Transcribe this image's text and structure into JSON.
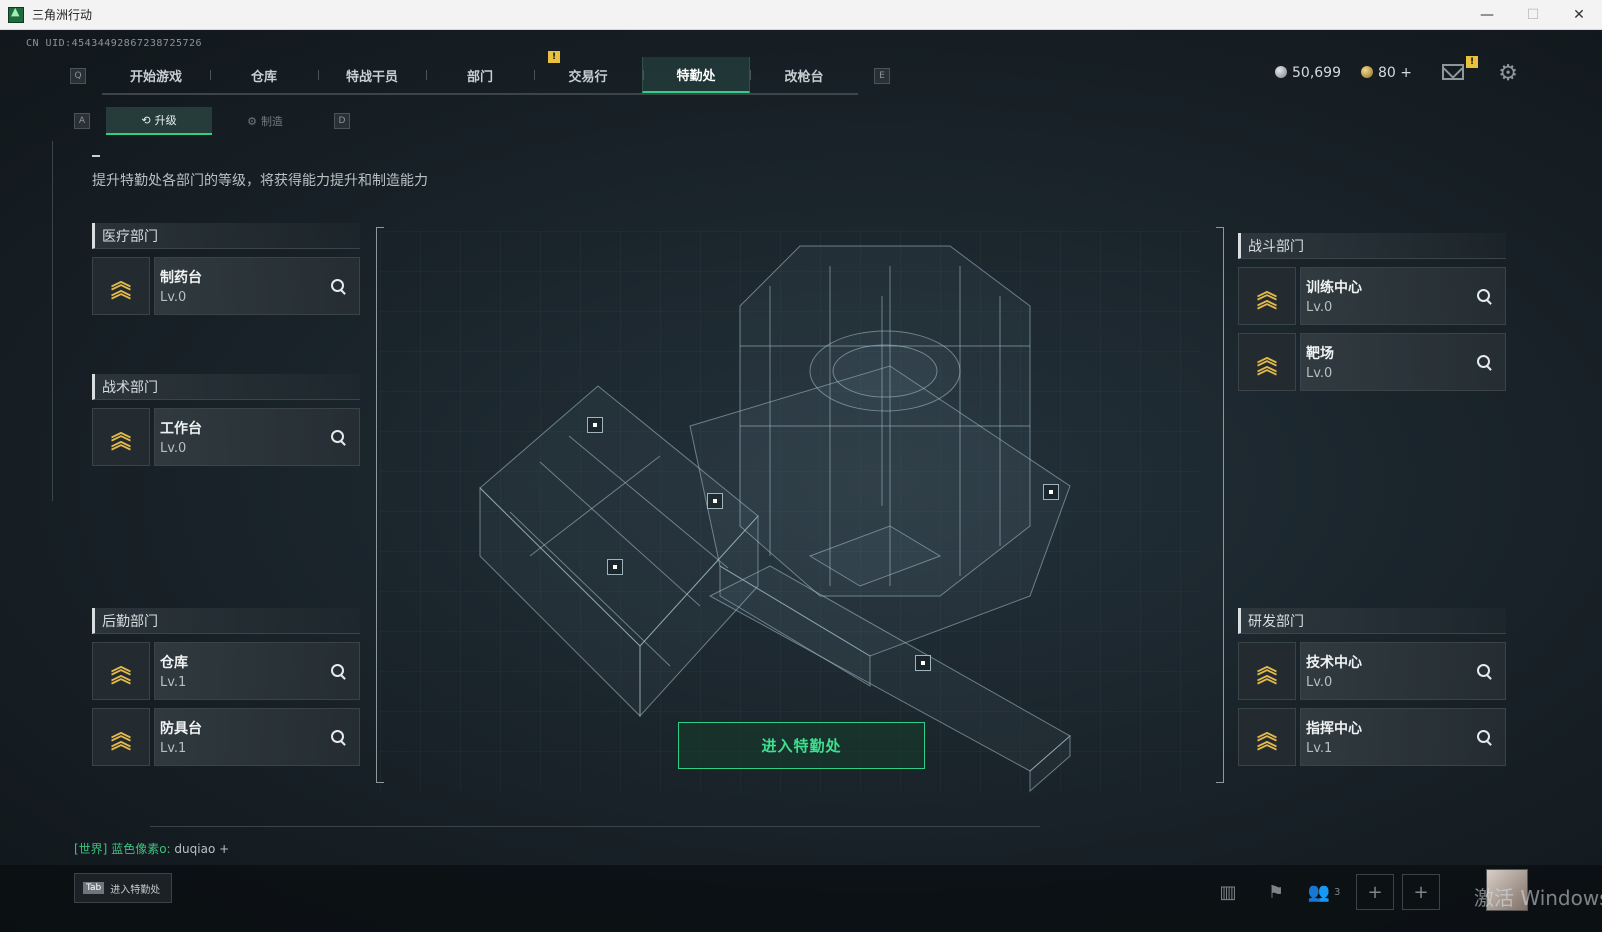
{
  "window": {
    "title": "三角洲行动",
    "minimize": "—",
    "maximize": "☐",
    "close": "✕"
  },
  "uid": "CN UID:4543449286723872572​6",
  "nav": {
    "left_key": "Q",
    "right_key": "E",
    "tabs": [
      "开始游戏",
      "仓库",
      "特战干员",
      "部门",
      "交易行",
      "特勤处",
      "改枪台"
    ],
    "active_tab": "特勤处",
    "warn_badge": "!"
  },
  "currency": {
    "silver": "50,699",
    "gold": "80 +"
  },
  "mail_badge": "!",
  "subtabs": {
    "left_key": "A",
    "right_key": "D",
    "upgrade": "升级",
    "craft": "制造"
  },
  "description": "提升特勤处各部门的等级，将获得能力提升和制造能力",
  "departments": {
    "medical": {
      "title": "医疗部门",
      "facilities": [
        {
          "name": "制药台",
          "level": "Lv.0"
        }
      ]
    },
    "tactical": {
      "title": "战术部门",
      "facilities": [
        {
          "name": "工作台",
          "level": "Lv.0"
        }
      ]
    },
    "logistics": {
      "title": "后勤部门",
      "facilities": [
        {
          "name": "仓库",
          "level": "Lv.1"
        },
        {
          "name": "防具台",
          "level": "Lv.1"
        }
      ]
    },
    "combat": {
      "title": "战斗部门",
      "facilities": [
        {
          "name": "训练中心",
          "level": "Lv.0"
        },
        {
          "name": "靶场",
          "level": "Lv.0"
        }
      ]
    },
    "research": {
      "title": "研发部门",
      "facilities": [
        {
          "name": "技术中心",
          "level": "Lv.0"
        },
        {
          "name": "指挥中心",
          "level": "Lv.1"
        }
      ]
    }
  },
  "enter_button": "进入特勤处",
  "chat": {
    "channel": "[世界]",
    "user": "蓝色像素o:",
    "message": "duqiao +"
  },
  "bottom": {
    "tab_key": "Tab",
    "tab_label": "进入特勤处",
    "squad_count": "3"
  },
  "watermark": "激活 Windows"
}
